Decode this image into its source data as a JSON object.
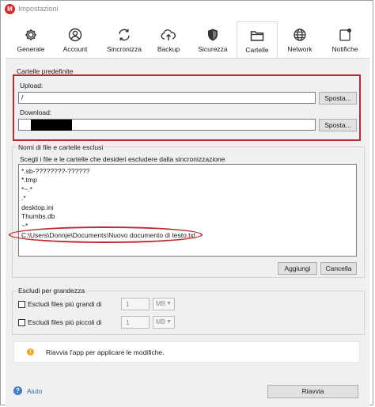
{
  "window": {
    "title": "Impostazioni",
    "app_logo_letter": "M",
    "brand_color": "#d9272e"
  },
  "tabs": [
    {
      "label": "Generale",
      "icon": "gear-icon"
    },
    {
      "label": "Account",
      "icon": "user-icon"
    },
    {
      "label": "Sincronizza",
      "icon": "sync-icon"
    },
    {
      "label": "Backup",
      "icon": "cloud-upload-icon"
    },
    {
      "label": "Sicurezza",
      "icon": "shield-icon"
    },
    {
      "label": "Cartelle",
      "icon": "folder-icon",
      "active": true
    },
    {
      "label": "Network",
      "icon": "globe-icon"
    },
    {
      "label": "Notifiche",
      "icon": "bell-icon"
    }
  ],
  "default_folders": {
    "title": "Cartelle predefinite",
    "upload_label": "Upload:",
    "upload_value": "/",
    "download_label": "Download:",
    "download_value": "",
    "move_button": "Sposta..."
  },
  "exclusions": {
    "title": "Nomi di file e cartelle esclusi",
    "description": "Scegli i file e le cartelle che desideri escludere dalla sincronizzazione",
    "items": [
      "*.sb-????????-??????",
      "*.tmp",
      "*~.*",
      ".*",
      "desktop.ini",
      "Thumbs.db",
      "~*",
      "C:\\Users\\Donnje\\Documents\\Nuovo documento di testo.txt"
    ],
    "add_button": "Aggiungi",
    "delete_button": "Cancella"
  },
  "size_exclusion": {
    "title": "Escludi per grandezza",
    "larger_label": "Escludi files più grandi di",
    "larger_value": "1",
    "smaller_label": "Escludi files più piccoli di",
    "smaller_value": "1",
    "unit": "MB"
  },
  "notice": {
    "text": "Riavvia l'app per applicare le modifiche.",
    "icon": "warning-icon",
    "icon_symbol": "!",
    "icon_color": "#f2a81d"
  },
  "footer": {
    "help_label": "Aiuto",
    "help_symbol": "?",
    "restart_button": "Riavvia"
  }
}
